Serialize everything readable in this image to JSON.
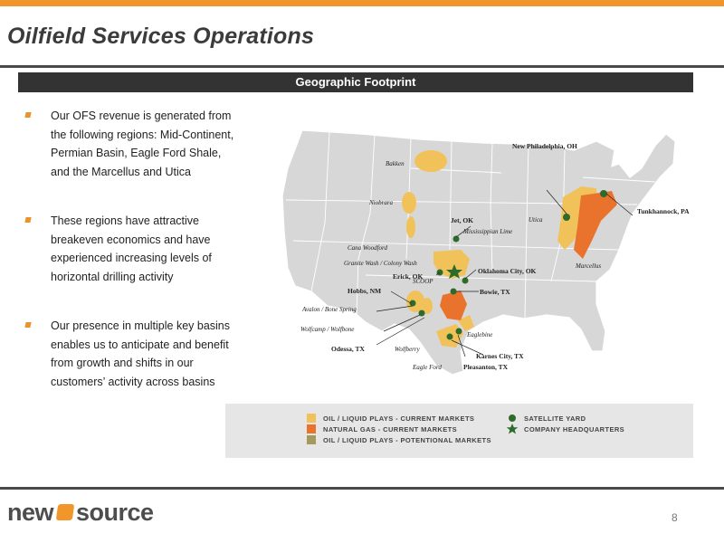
{
  "header": {
    "title": "Oilfield Services Operations"
  },
  "section": {
    "title": "Geographic Footprint"
  },
  "bullets": [
    "Our OFS revenue is generated from the following regions: Mid-Continent, Permian Basin, Eagle Ford Shale, and the Marcellus and Utica",
    "These regions have attractive breakeven economics and have experienced increasing levels of horizontal drilling activity",
    "Our presence in multiple key basins enables us to anticipate and benefit from growth and shifts in our customers’ activity across basins"
  ],
  "map": {
    "plays": {
      "bakken": "Bakken",
      "niobrara": "Niobrara",
      "utica": "Utica",
      "marcellus": "Marcellus",
      "mississippian": "Mississippian Lime",
      "cana": "Cana Woodford",
      "granite": "Granite Wash / Colony Wash",
      "scoop": "SCOOP",
      "avalon": "Avalon / Bone Spring",
      "wolfcamp": "Wolfcamp / Wolfbone",
      "wolfberry": "Wolfberry",
      "eagle_ford": "Eagle Ford",
      "eaglebine": "Eaglebine"
    },
    "locations": {
      "new_philadelphia": "New Philadelphia, OH",
      "tunkhannock": "Tunkhannock, PA",
      "jet": "Jet, OK",
      "erick": "Erick, OK",
      "oklahoma_city": "Oklahoma City, OK",
      "bowie": "Bowie, TX",
      "hobbs": "Hobbs, NM",
      "odessa": "Odessa, TX",
      "karnes": "Karnes City, TX",
      "pleasanton": "Pleasanton, TX"
    }
  },
  "legend": {
    "oil_current": "OIL / LIQUID PLAYS - CURRENT MARKETS",
    "gas_current": "NATURAL GAS - CURRENT MARKETS",
    "oil_potential": "OIL / LIQUID PLAYS - POTENTIONAL MARKETS",
    "satellite": "SATELLITE YARD",
    "hq": "COMPANY HEADQUARTERS"
  },
  "colors": {
    "accent": "#f0962b",
    "oil_current": "#f2c25a",
    "gas_current": "#e9732d",
    "oil_potential": "#a59a5c",
    "satellite": "#2d6b2a",
    "map_land": "#d7d7d7"
  },
  "footer": {
    "logo_left": "new",
    "logo_right": "source",
    "page_number": "8"
  }
}
